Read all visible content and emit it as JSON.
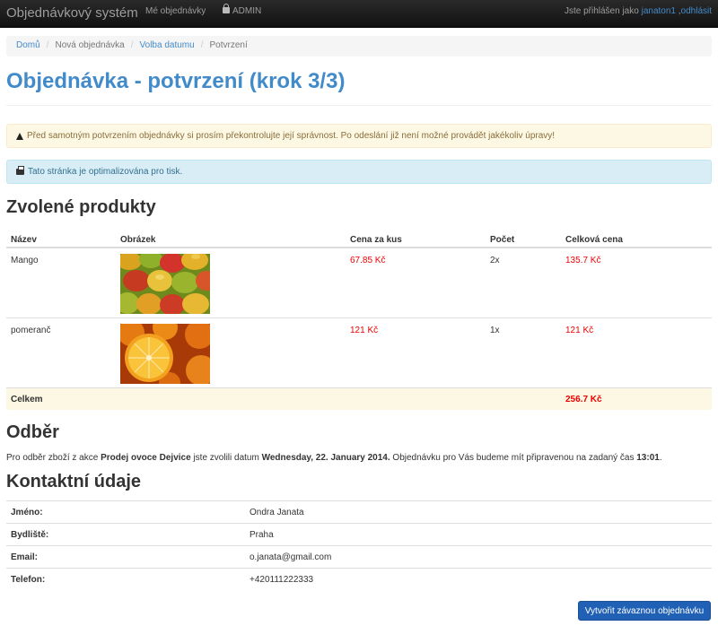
{
  "navbar": {
    "brand": "Objednávkový systém",
    "my_orders": "Mé objednávky",
    "admin": "ADMIN",
    "logged_in_prefix": "Jste přihlášen jako ",
    "username": "janaton1",
    "separator": " ,",
    "logout": "odhlásit"
  },
  "breadcrumb": {
    "items": [
      "Domů",
      "Nová objednávka",
      "Volba datumu",
      "Potvrzení"
    ]
  },
  "page_title": "Objednávka - potvrzení (krok 3/3)",
  "alerts": {
    "warning": "Před samotným potvrzením objednávky si prosím překontrolujte její správnost. Po odeslání již není možné provádět jakékoliv úpravy!",
    "info": "Tato stránka je optimalizována pro tisk."
  },
  "products": {
    "heading": "Zvolené produkty",
    "columns": [
      "Název",
      "Obrázek",
      "Cena za kus",
      "Počet",
      "Celková cena"
    ],
    "rows": [
      {
        "name": "Mango",
        "image": "mango-photo",
        "unit_price": "67.85 Kč",
        "qty": "2x",
        "total": "135.7 Kč"
      },
      {
        "name": "pomeranč",
        "image": "orange-photo",
        "unit_price": "121 Kč",
        "qty": "1x",
        "total": "121 Kč"
      }
    ],
    "total_label": "Celkem",
    "total_value": "256.7 Kč"
  },
  "pickup": {
    "heading": "Odběr",
    "text_1": "Pro odběr zboží z akce ",
    "event": "Prodej ovoce Dejvice",
    "text_2": " jste zvolili datum ",
    "date": "Wednesday, 22. January 2014.",
    "text_3": " Objednávku pro Vás budeme mít připravenou na zadaný čas ",
    "time": "13:01",
    "text_4": "."
  },
  "contact": {
    "heading": "Kontaktní údaje",
    "rows": [
      {
        "label": "Jméno:",
        "value": "Ondra Janata"
      },
      {
        "label": "Bydliště:",
        "value": "Praha"
      },
      {
        "label": "Email:",
        "value": "o.janata@gmail.com"
      },
      {
        "label": "Telefon:",
        "value": "+420111222333"
      }
    ]
  },
  "submit_button": "Vytvořit závaznou objednávku",
  "colors": {
    "link": "#428bca",
    "price": "#ee0000",
    "warning_bg": "#fcf8e3",
    "info_bg": "#d9edf7",
    "button": "#2061b5"
  }
}
